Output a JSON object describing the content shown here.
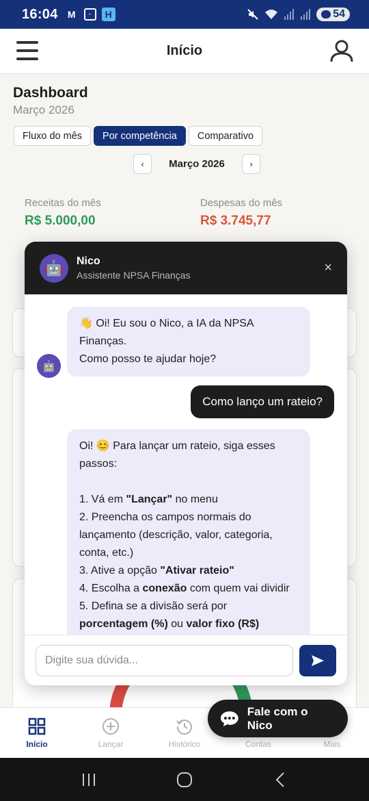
{
  "status_bar": {
    "time": "16:04",
    "battery": "54"
  },
  "header": {
    "title": "Início"
  },
  "dashboard": {
    "title": "Dashboard",
    "subtitle": "Março 2026",
    "tabs": [
      {
        "label": "Fluxo do mês",
        "active": false
      },
      {
        "label": "Por competência",
        "active": true
      },
      {
        "label": "Comparativo",
        "active": false
      }
    ],
    "month_nav": {
      "prev": "‹",
      "label": "Março 2026",
      "next": "›"
    },
    "income": {
      "label": "Receitas do mês",
      "value": "R$ 5.000,00"
    },
    "expenses": {
      "label": "Despesas do mês",
      "value": "R$ 3.745,77"
    }
  },
  "chat": {
    "bot_name": "Nico",
    "bot_role": "Assistente NPSA Finanças",
    "close": "×",
    "messages": {
      "greeting": {
        "line1": "👋 Oi! Eu sou o Nico, a IA da NPSA",
        "line2": "Finanças.",
        "line3": "Como posso te ajudar hoje?"
      },
      "user_question": "Como lanço um rateio?",
      "answer": {
        "intro1": "Oi! 😊 Para lançar um rateio, siga esses",
        "intro2": "passos:",
        "s1_pre": "1. Vá em ",
        "s1_bold": "\"Lançar\"",
        "s1_post": " no menu",
        "s2a": "2. Preencha os campos normais do",
        "s2b": "lançamento (descrição, valor, categoria,",
        "s2c": "conta, etc.)",
        "s3_pre": "3. Ative a opção ",
        "s3_bold": "\"Ativar rateio\"",
        "s4_pre": "4. Escolha a ",
        "s4_bold": "conexão",
        "s4_post": " com quem vai dividir",
        "s5a": "5. Defina se a divisão será por",
        "s5_bold1": "porcentagem (%)",
        "s5_mid": " ou ",
        "s5_bold2": "valor fixo (R$)"
      }
    },
    "input_placeholder": "Digite sua dúvida...",
    "input_value": "",
    "send_icon": "send-icon"
  },
  "bottom_nav": [
    {
      "label": "Início",
      "icon": "grid-icon",
      "active": true
    },
    {
      "label": "Lançar",
      "icon": "plus-circle-icon",
      "active": false
    },
    {
      "label": "Histórico",
      "icon": "history-icon",
      "active": false
    },
    {
      "label": "Contas",
      "icon": "wallet-icon",
      "active": false
    },
    {
      "label": "Mais",
      "icon": "more-icon",
      "active": false
    }
  ],
  "fab": {
    "label": "Fale com o Nico"
  },
  "colors": {
    "brand": "#14317a",
    "income": "#2e9a5b",
    "expense": "#d6573c",
    "chat_dark": "#1d1d1d",
    "bot_bubble": "#ebebfa"
  }
}
